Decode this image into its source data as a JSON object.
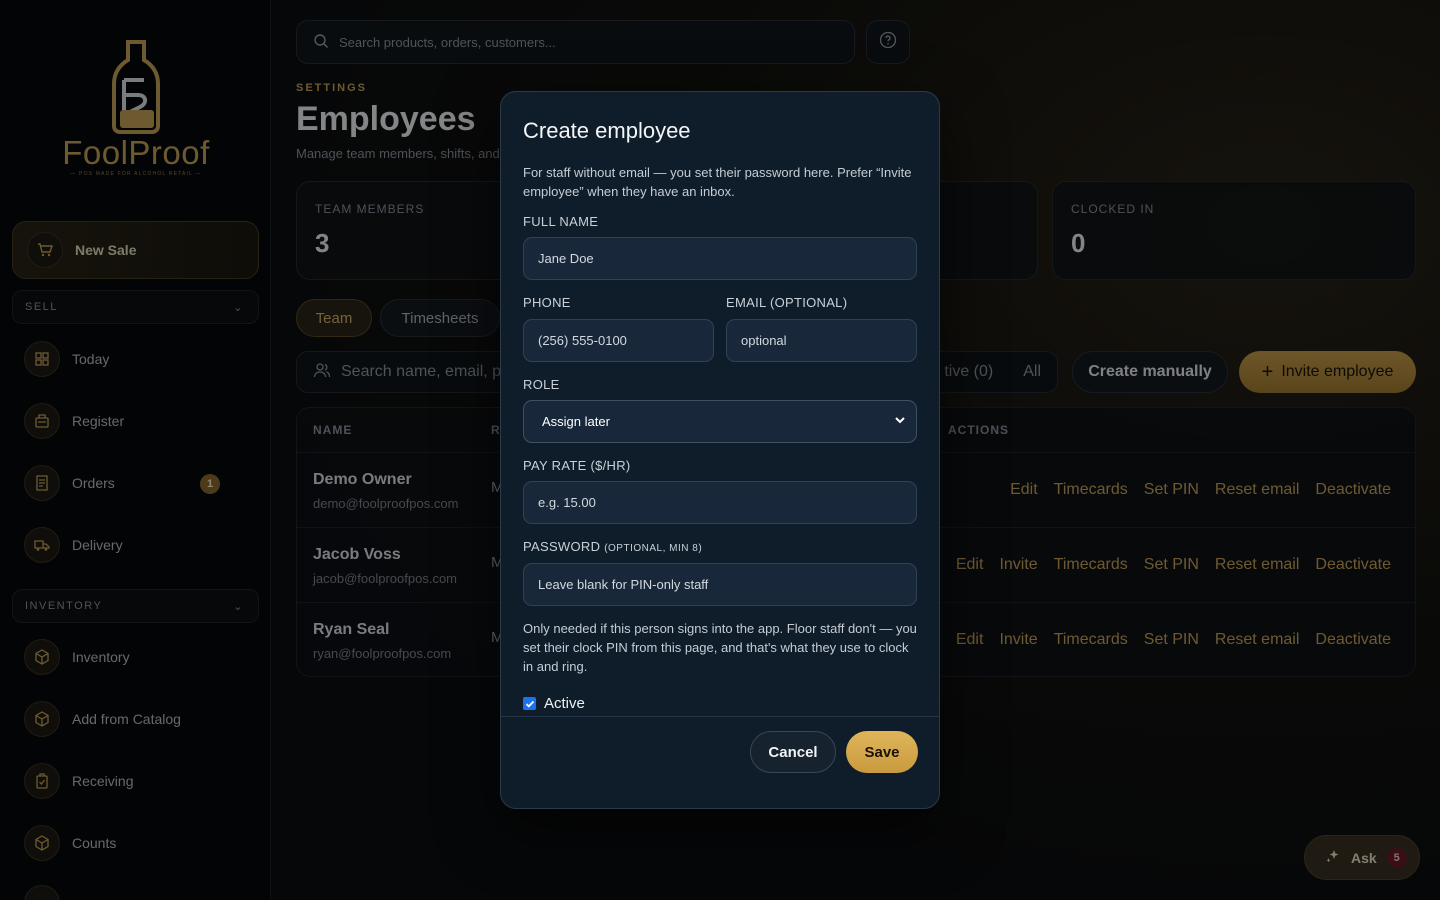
{
  "brand": {
    "name": "FoolProof",
    "tagline": "POS MADE FOR ALCOHOL RETAIL"
  },
  "sidebar": {
    "new_sale": "New Sale",
    "sell_section": "SELL",
    "sell_items": [
      {
        "label": "Today",
        "icon": "dashboard-icon"
      },
      {
        "label": "Register",
        "icon": "register-icon"
      },
      {
        "label": "Orders",
        "icon": "receipt-icon",
        "badge": "1"
      },
      {
        "label": "Delivery",
        "icon": "truck-icon"
      }
    ],
    "inventory_section": "INVENTORY",
    "inventory_items": [
      {
        "label": "Inventory",
        "icon": "box-icon"
      },
      {
        "label": "Add from Catalog",
        "icon": "box-icon"
      },
      {
        "label": "Receiving",
        "icon": "clipboard-icon"
      },
      {
        "label": "Counts",
        "icon": "box-icon"
      }
    ]
  },
  "topbar": {
    "search_placeholder": "Search products, orders, customers..."
  },
  "page": {
    "eyebrow": "SETTINGS",
    "title": "Employees",
    "subtitle": "Manage team members, shifts, and access"
  },
  "stats": [
    {
      "label": "TEAM MEMBERS",
      "value": "3"
    },
    {
      "label": "CLOCKED IN",
      "value": "0"
    }
  ],
  "tabs": [
    {
      "label": "Team"
    },
    {
      "label": "Timesheets"
    }
  ],
  "team_search_placeholder": "Search name, email, phone",
  "filters": {
    "inactive": "tive (0)",
    "all": "All"
  },
  "buttons": {
    "create_manually": "Create manually",
    "invite": "Invite employee"
  },
  "table": {
    "headers": {
      "name": "NAME",
      "role": "RO",
      "actions": "ACTIONS"
    },
    "rows": [
      {
        "name": "Demo Owner",
        "email": "demo@foolproofpos.com",
        "role": "M",
        "actions": [
          "Edit",
          "Timecards",
          "Set PIN",
          "Reset email",
          "Deactivate"
        ]
      },
      {
        "name": "Jacob Voss",
        "email": "jacob@foolproofpos.com",
        "role": "M",
        "actions": [
          "Edit",
          "Invite",
          "Timecards",
          "Set PIN",
          "Reset email",
          "Deactivate"
        ]
      },
      {
        "name": "Ryan Seal",
        "email": "ryan@foolproofpos.com",
        "role": "M",
        "actions": [
          "Edit",
          "Invite",
          "Timecards",
          "Set PIN",
          "Reset email",
          "Deactivate"
        ]
      }
    ]
  },
  "ask": {
    "label": "Ask",
    "badge": "5"
  },
  "modal": {
    "title": "Create employee",
    "intro": "For staff without email — you set their password here. Prefer “Invite employee” when they have an inbox.",
    "full_name_label": "FULL NAME",
    "full_name_placeholder": "Jane Doe",
    "phone_label": "PHONE",
    "phone_value": "(256) 555-0100",
    "email_label": "EMAIL (OPTIONAL)",
    "email_placeholder": "optional",
    "role_label": "ROLE",
    "role_value": "Assign later",
    "pay_label": "PAY RATE ($/HR)",
    "pay_placeholder": "e.g. 15.00",
    "password_label": "PASSWORD",
    "password_hint": "(OPTIONAL, MIN 8)",
    "password_placeholder": "Leave blank for PIN-only staff",
    "help_text": "Only needed if this person signs into the app. Floor staff don't — you set their clock PIN from this page, and that's what they use to clock in and ring.",
    "active_label": "Active",
    "active_checked": true,
    "cancel": "Cancel",
    "save": "Save"
  }
}
